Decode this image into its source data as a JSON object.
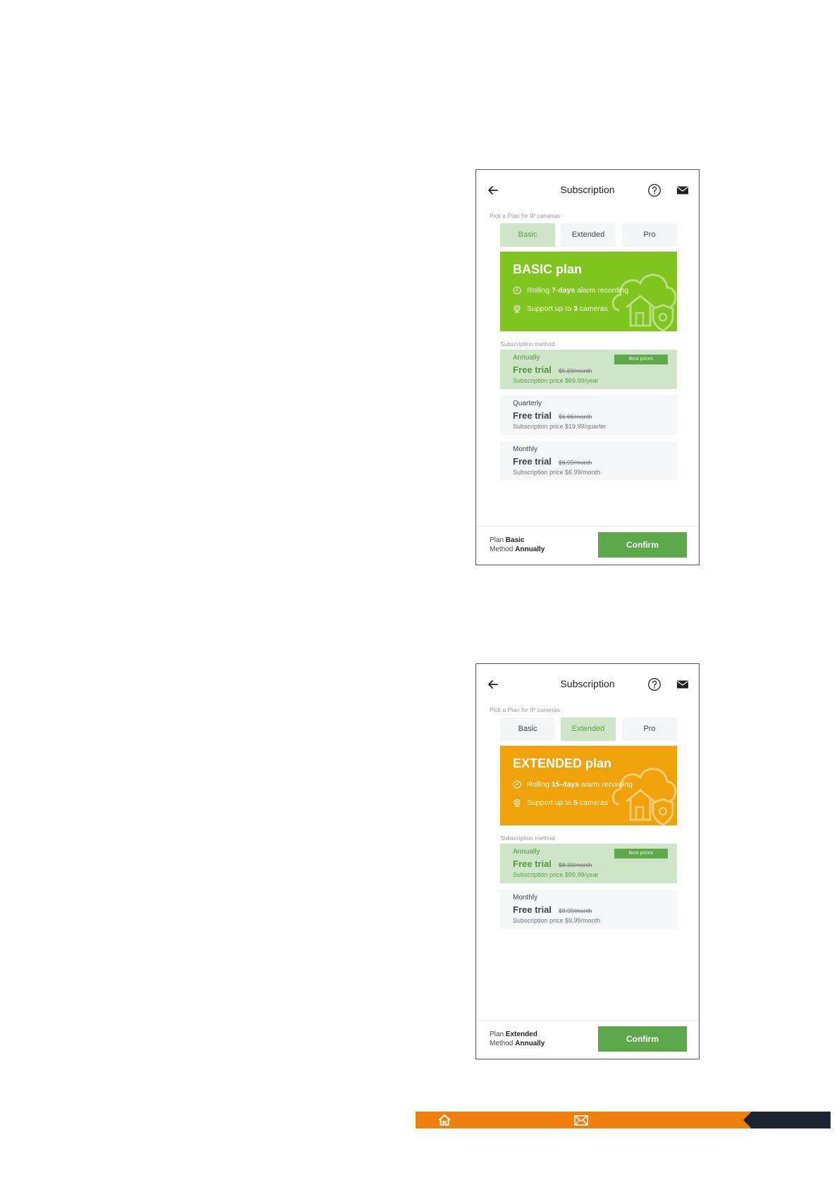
{
  "screens": [
    {
      "header": {
        "title": "Subscription"
      },
      "pick_label": "Pick a Plan for IP cameras",
      "tabs": [
        {
          "label": "Basic",
          "active": true
        },
        {
          "label": "Extended",
          "active": false
        },
        {
          "label": "Pro",
          "active": false
        }
      ],
      "banner": {
        "name": "BASIC plan",
        "color": "#80c41f",
        "feature1": {
          "pre": "Rolling ",
          "bold": "7-days",
          "post": " alarm recording"
        },
        "feature2": {
          "pre": "Support up to  ",
          "bold": "3",
          "post": " cameras"
        }
      },
      "method_label": "Subscription method",
      "options": [
        {
          "name": "Annually",
          "trial": "Free trial",
          "strike": "$5.83/month",
          "sub": "Subscription price $69.99/year",
          "badge": "Best prices",
          "selected": true
        },
        {
          "name": "Quarterly",
          "trial": "Free trial",
          "strike": "$6.66/month",
          "sub": "Subscription price $19.99/quarter",
          "badge": "",
          "selected": false
        },
        {
          "name": "Monthly",
          "trial": "Free trial",
          "strike": "$6.99/month",
          "sub": "Subscription price $6.99/month",
          "badge": "",
          "selected": false
        }
      ],
      "footer": {
        "plan_label": "Plan",
        "plan_value": "Basic",
        "method_label": "Method",
        "method_value": "Annually",
        "confirm": "Confirm"
      }
    },
    {
      "header": {
        "title": "Subscription"
      },
      "pick_label": "Pick a Plan for IP cameras",
      "tabs": [
        {
          "label": "Basic",
          "active": false
        },
        {
          "label": "Extended",
          "active": true
        },
        {
          "label": "Pro",
          "active": false
        }
      ],
      "banner": {
        "name": "EXTENDED plan",
        "color": "#f0a20a",
        "feature1": {
          "pre": "Rolling ",
          "bold": "15-days",
          "post": " alarm recording"
        },
        "feature2": {
          "pre": "Support up to  ",
          "bold": "5",
          "post": " cameras"
        }
      },
      "method_label": "Subscription method",
      "options": [
        {
          "name": "Annually",
          "trial": "Free trial",
          "strike": "$8.33/month",
          "sub": "Subscription price $99.99/year",
          "badge": "Best prices",
          "selected": true
        },
        {
          "name": "Monthly",
          "trial": "Free trial",
          "strike": "$9.99/month",
          "sub": "Subscription price $9.99/month",
          "badge": "",
          "selected": false
        }
      ],
      "footer": {
        "plan_label": "Plan",
        "plan_value": "Extended",
        "method_label": "Method",
        "method_value": "Annually",
        "confirm": "Confirm"
      }
    }
  ],
  "bottom_bar": {
    "icons": [
      "home-icon",
      "mail-icon"
    ],
    "colors": {
      "orange": "#f07e0a",
      "dark": "#1b2533"
    }
  }
}
